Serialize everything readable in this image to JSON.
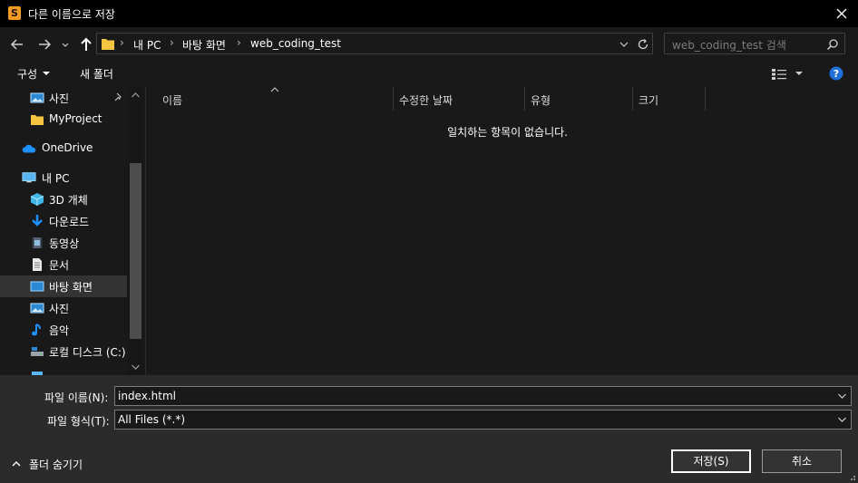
{
  "window": {
    "app_icon_letter": "S",
    "title": "다른 이름으로 저장"
  },
  "address": {
    "path": [
      "내 PC",
      "바탕 화면",
      "web_coding_test"
    ],
    "search_placeholder": "web_coding_test 검색"
  },
  "toolbar": {
    "organize_label": "구성",
    "new_folder_label": "새 폴더"
  },
  "sidebar": {
    "items": [
      {
        "label": "사진",
        "icon": "pictures-icon",
        "pinned": true
      },
      {
        "label": "MyProject",
        "icon": "folder-icon"
      },
      {
        "label": "OneDrive",
        "icon": "cloud-icon"
      },
      {
        "label": "내 PC",
        "icon": "computer-icon"
      },
      {
        "label": "3D 개체",
        "icon": "cube-icon"
      },
      {
        "label": "다운로드",
        "icon": "download-icon"
      },
      {
        "label": "동영상",
        "icon": "video-icon"
      },
      {
        "label": "문서",
        "icon": "document-icon"
      },
      {
        "label": "바탕 화면",
        "icon": "desktop-icon",
        "selected": true
      },
      {
        "label": "사진",
        "icon": "pictures-icon"
      },
      {
        "label": "음악",
        "icon": "music-icon"
      },
      {
        "label": "로컬 디스크 (C:)",
        "icon": "drive-icon"
      }
    ]
  },
  "file_list": {
    "columns": [
      "이름",
      "수정한 날짜",
      "유형",
      "크기"
    ],
    "sorted_column": "이름",
    "empty_message": "일치하는 항목이 없습니다."
  },
  "save_form": {
    "filename_label": "파일 이름(N):",
    "filename_value": "index.html",
    "filetype_label": "파일 형식(T):",
    "filetype_value": "All Files (*.*)",
    "hide_folders_label": "폴더 숨기기",
    "save_label": "저장(S)",
    "cancel_label": "취소"
  },
  "colors": {
    "background": "#191919",
    "title_bar": "#000000",
    "bottom_panel": "#2b2b2b",
    "selection": "#333333",
    "accent_blue": "#1e90ff",
    "folder_yellow": "#f5c542"
  }
}
